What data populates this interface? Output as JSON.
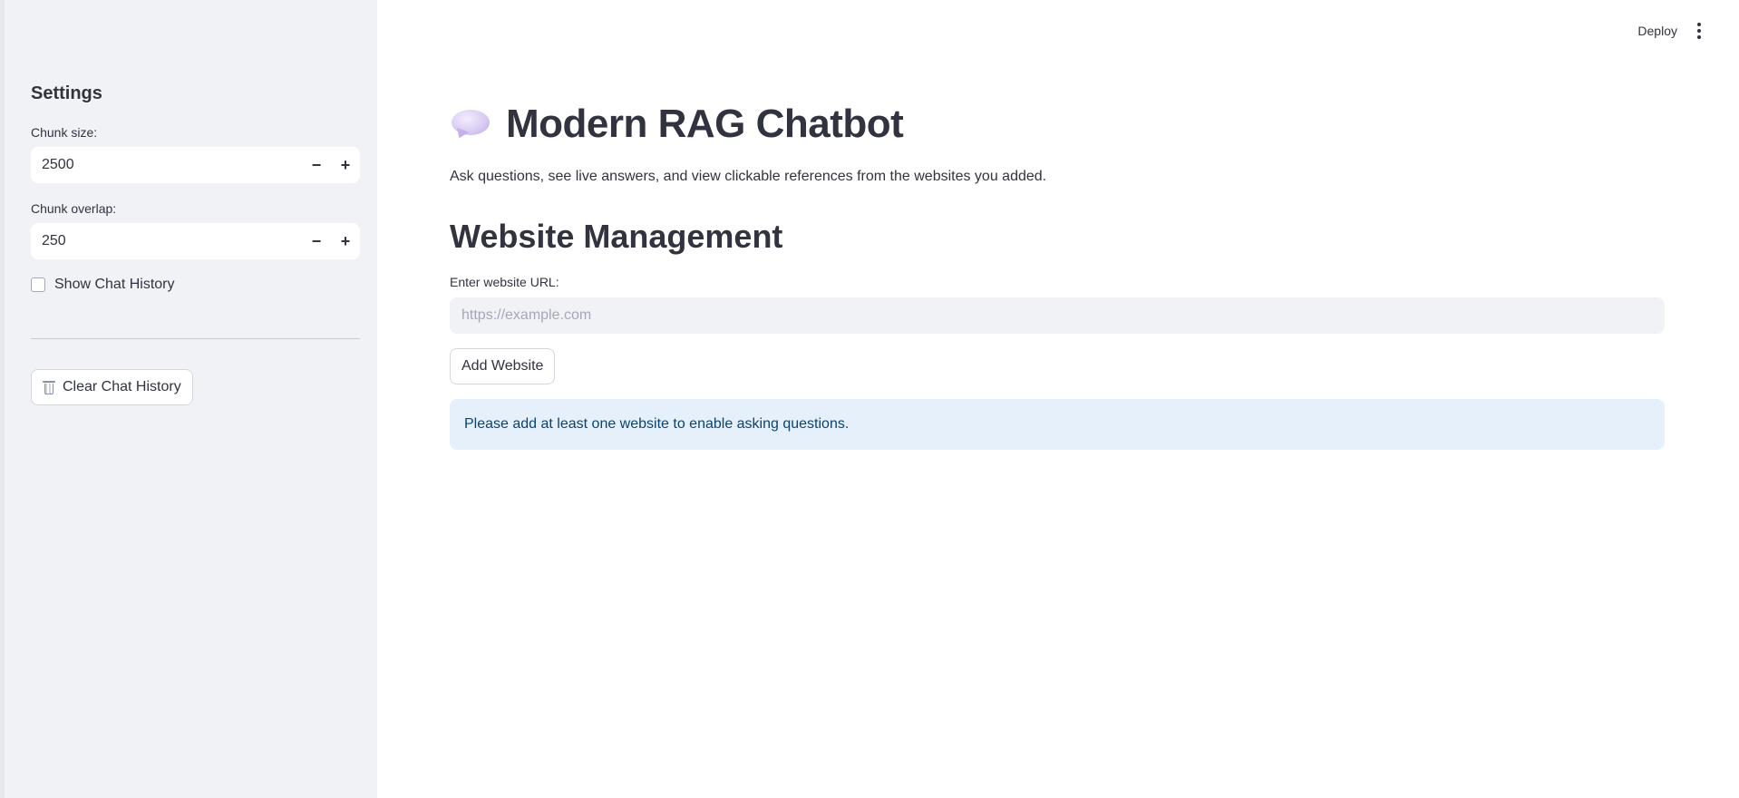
{
  "sidebar": {
    "title": "Settings",
    "chunk_size": {
      "label": "Chunk size:",
      "value": "2500",
      "minus": "−",
      "plus": "+"
    },
    "chunk_overlap": {
      "label": "Chunk overlap:",
      "value": "250",
      "minus": "−",
      "plus": "+"
    },
    "show_history": {
      "label": "Show Chat History",
      "checked": false
    },
    "clear_button": {
      "label": "Clear Chat History",
      "icon": "wastebasket-icon"
    }
  },
  "header": {
    "deploy_label": "Deploy",
    "menu_icon": "kebab-menu-icon"
  },
  "main": {
    "title_icon": "speech-balloon-icon",
    "title": "Modern RAG Chatbot",
    "subtitle": "Ask questions, see live answers, and view clickable references from the websites you added.",
    "section_title": "Website Management",
    "url_field": {
      "label": "Enter website URL:",
      "placeholder": "https://example.com",
      "value": ""
    },
    "add_button": "Add Website",
    "info_message": "Please add at least one website to enable asking questions."
  },
  "colors": {
    "sidebar_bg": "#f0f2f6",
    "text": "#31333f",
    "info_bg": "#e6f0fb",
    "info_text": "#0b4270"
  }
}
